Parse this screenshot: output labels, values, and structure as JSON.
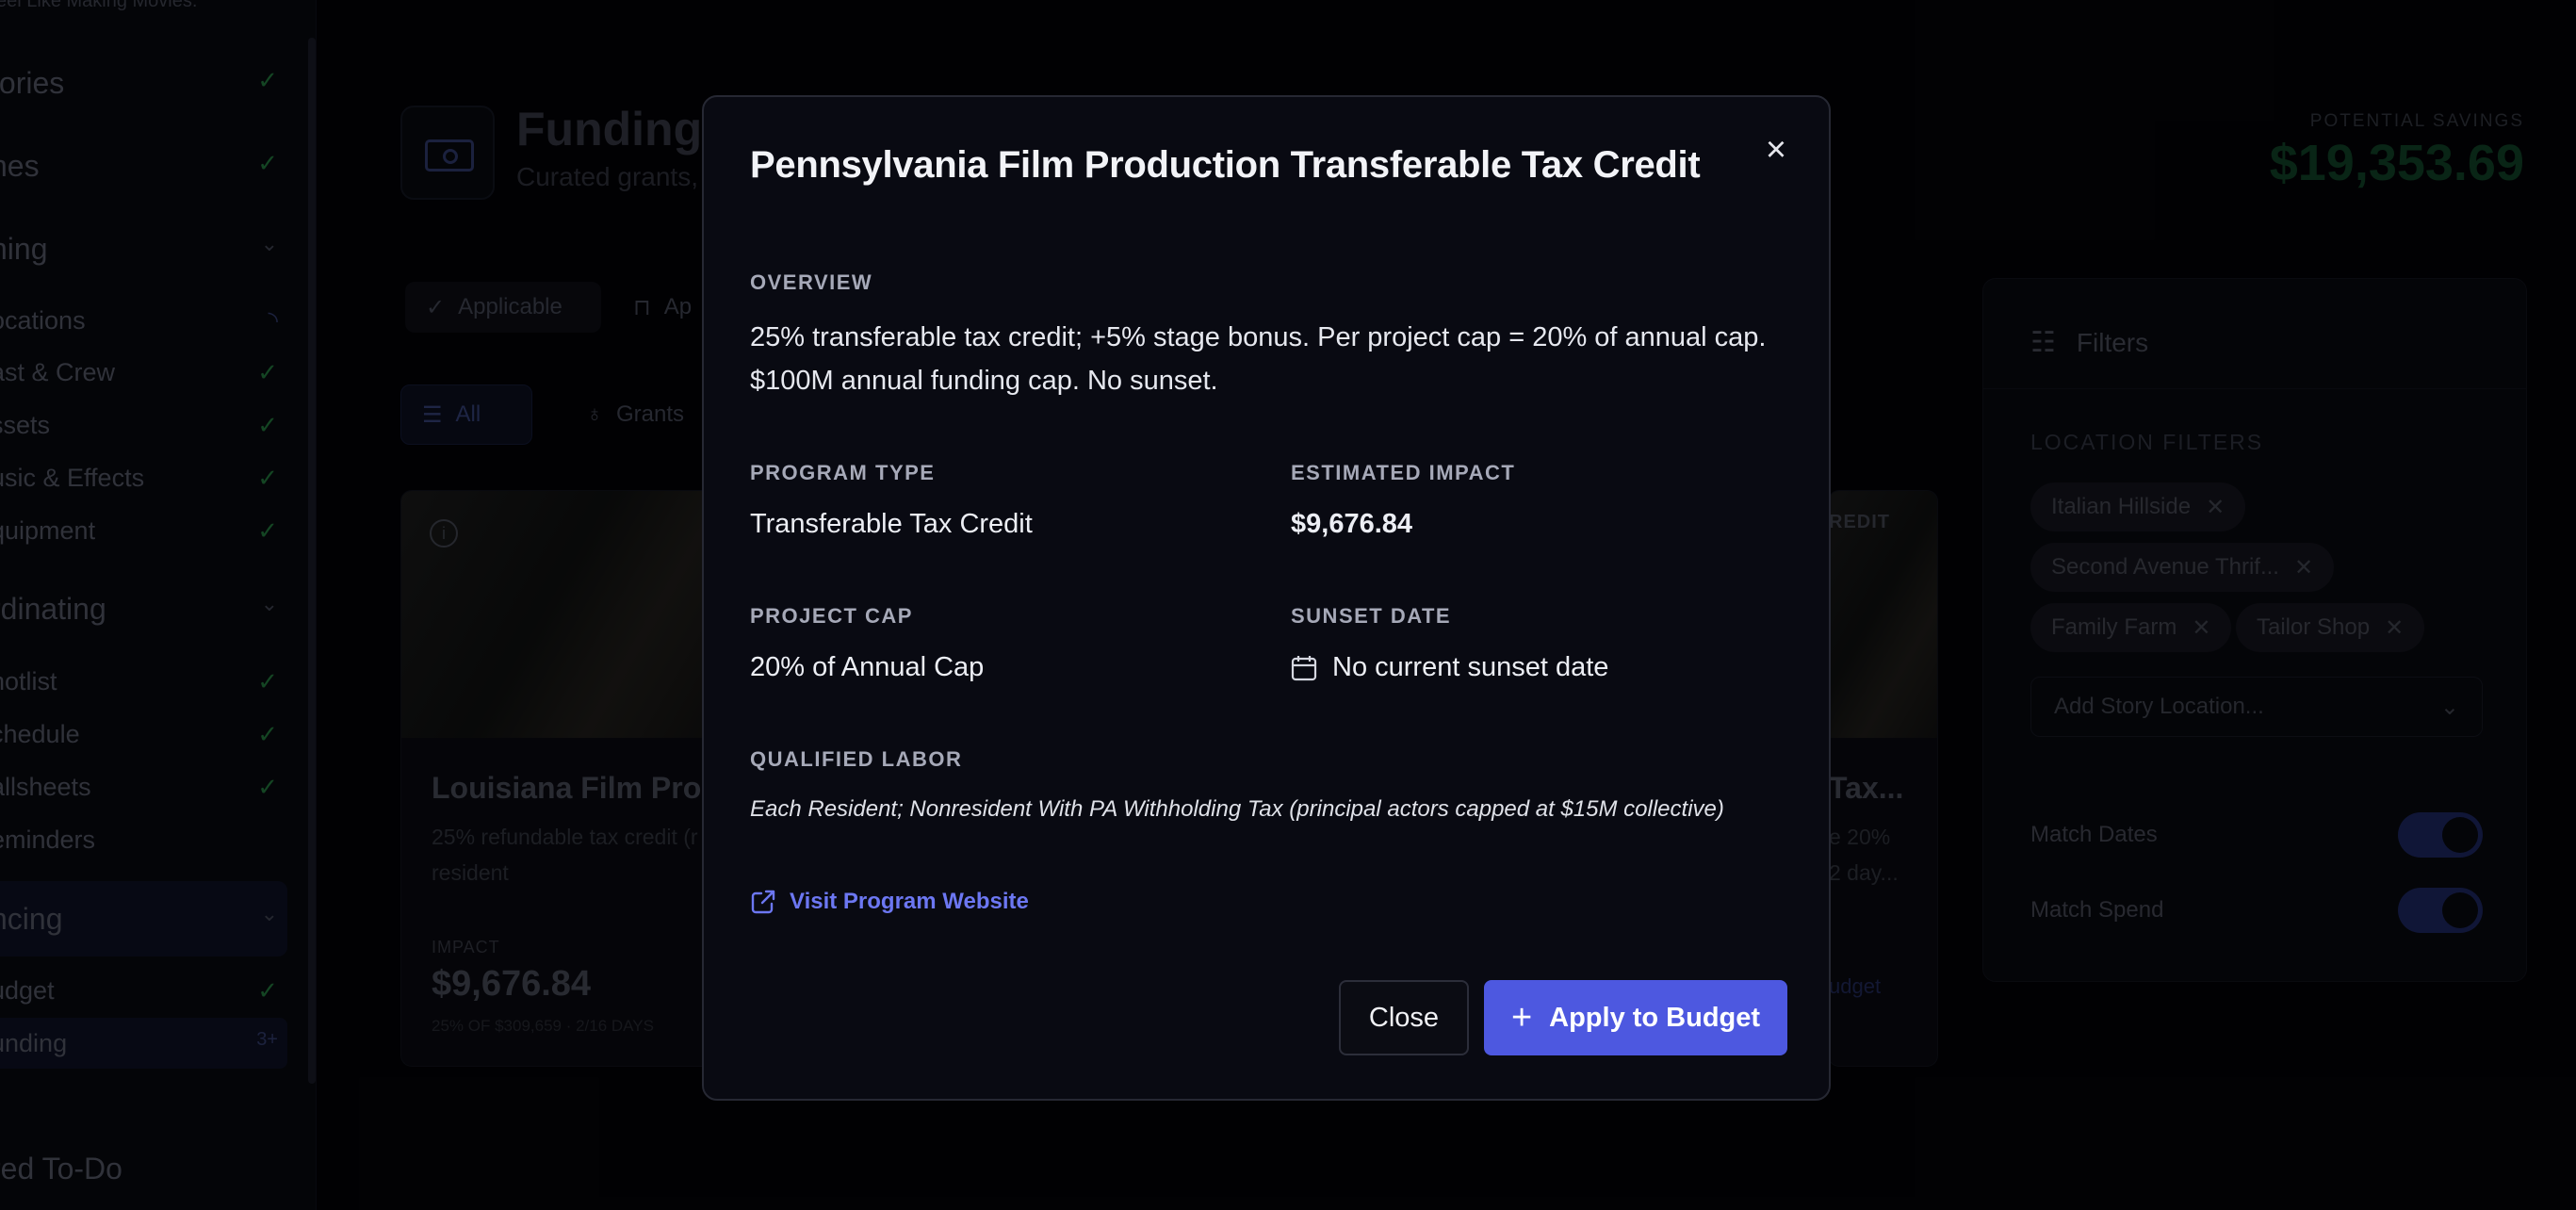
{
  "sidebar": {
    "tagline": "eel Like Making Movies.",
    "items": [
      {
        "label": "tories",
        "state": "done"
      },
      {
        "label": "nes",
        "state": "done"
      },
      {
        "label": "ning",
        "state": "expanded"
      },
      {
        "label": "ocations",
        "state": "loading"
      },
      {
        "label": "ast & Crew",
        "state": "done"
      },
      {
        "label": "ssets",
        "state": "done"
      },
      {
        "label": "usic & Effects",
        "state": "done"
      },
      {
        "label": "quipment",
        "state": "done"
      },
      {
        "label": "rdinating",
        "state": "expanded"
      },
      {
        "label": "notlist",
        "state": "done"
      },
      {
        "label": "chedule",
        "state": "done"
      },
      {
        "label": "allsheets",
        "state": "done"
      },
      {
        "label": "eminders",
        "state": "none"
      },
      {
        "label": "ncing",
        "state": "expanded"
      },
      {
        "label": "udget",
        "state": "done"
      },
      {
        "label": "unding",
        "state": "count"
      }
    ],
    "funding_count": "3+",
    "footer": "red To-Do"
  },
  "main": {
    "title": "Funding:",
    "subtitle": "Curated grants,",
    "potential_label": "POTENTIAL SAVINGS",
    "potential_value": "$19,353.69",
    "status_tabs": [
      "Applicable",
      "Ap"
    ],
    "type_tabs": [
      "All",
      "Grants"
    ],
    "card_left": {
      "title": "Louisiana Film Prod",
      "desc": "25% refundable tax credit (r transfer fee). +15% resident",
      "impact_label": "IMPACT",
      "impact_value": "$9,676.84",
      "impact_sub": "25% OF $309,659 · 2/16 DAYS"
    },
    "card_right": {
      "badge": "REDIT",
      "title": "Tax...",
      "desc": "e 20% 2 day...",
      "link": "udget"
    }
  },
  "filters": {
    "title": "Filters",
    "section": "LOCATION FILTERS",
    "tags": [
      "Italian Hillside",
      "Second Avenue Thrif...",
      "Family Farm",
      "Tailor Shop"
    ],
    "add_placeholder": "Add Story Location...",
    "toggles": [
      {
        "label": "Match Dates",
        "on": true
      },
      {
        "label": "Match Spend",
        "on": true
      }
    ]
  },
  "modal": {
    "title": "Pennsylvania Film Production Transferable Tax Credit",
    "overview_label": "OVERVIEW",
    "overview_text": "25% transferable tax credit; +5% stage bonus. Per project cap = 20% of annual cap. $100M annual funding cap. No sunset.",
    "program_type_label": "PROGRAM TYPE",
    "program_type_value": "Transferable Tax Credit",
    "impact_label": "ESTIMATED IMPACT",
    "impact_value": "$9,676.84",
    "project_cap_label": "PROJECT CAP",
    "project_cap_value": "20% of Annual Cap",
    "sunset_label": "SUNSET DATE",
    "sunset_value": "No current sunset date",
    "labor_label": "QUALIFIED LABOR",
    "labor_value": "Each Resident; Nonresident With PA Withholding Tax (principal actors capped at $15M collective)",
    "link_label": "Visit Program Website",
    "close_label": "Close",
    "apply_label": "Apply to Budget",
    "accent": "#4d58e0"
  }
}
